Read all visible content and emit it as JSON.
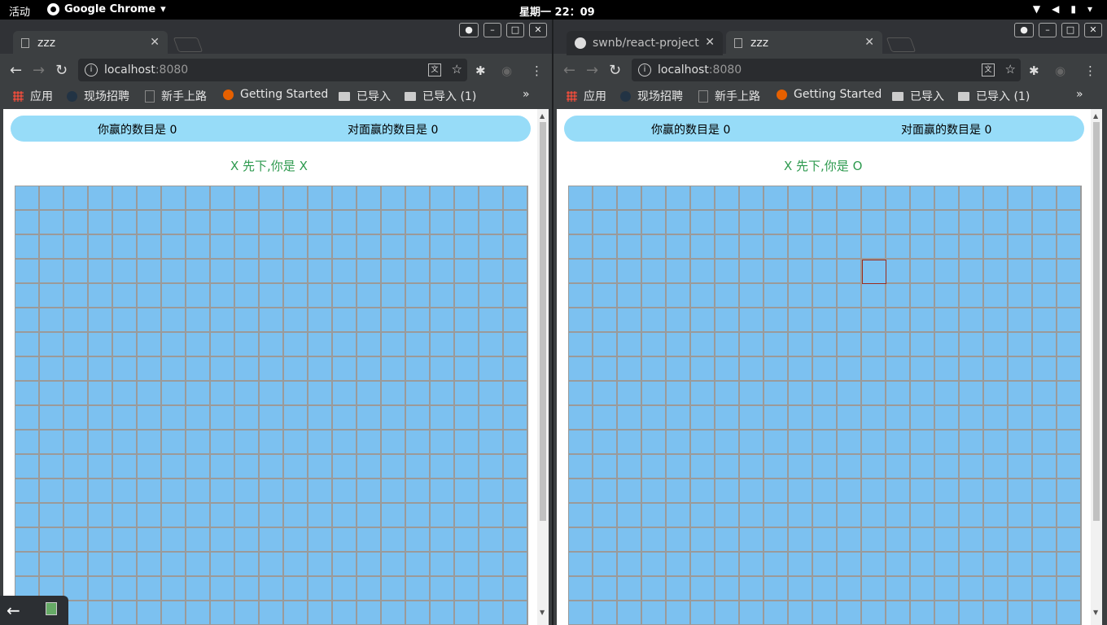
{
  "topbar": {
    "activities": "活动",
    "app_name": "Google Chrome",
    "clock": "星期一 22：09"
  },
  "left_window": {
    "tabs": [
      {
        "title": "zzz"
      }
    ],
    "url_host": "localhost",
    "url_port": ":8080",
    "bookmarks": [
      "应用",
      "现场招聘",
      "新手上路",
      "Getting Started",
      "已导入",
      "已导入 (1)"
    ],
    "more": "»",
    "page": {
      "my_wins": "你赢的数目是 0",
      "opponent_wins": "对面赢的数目是 0",
      "turn_text": "X 先下,你是 X"
    }
  },
  "right_window": {
    "tabs": [
      {
        "title": "swnb/react-project"
      },
      {
        "title": "zzz"
      }
    ],
    "url_host": "localhost",
    "url_port": ":8080",
    "bookmarks": [
      "应用",
      "现场招聘",
      "新手上路",
      "Getting Started",
      "已导入",
      "已导入 (1)"
    ],
    "more": "»",
    "page": {
      "my_wins": "你赢的数目是 0",
      "opponent_wins": "对面赢的数目是 0",
      "turn_text": "X 先下,你是 O"
    }
  },
  "board": {
    "columns": 21,
    "visible_rows": 18,
    "selected_cell_right": {
      "row": 3,
      "col": 12
    },
    "cell_color": "#7cc1f0",
    "grid_color": "#9a9a9a",
    "highlight_color": "#9b2c1c"
  }
}
